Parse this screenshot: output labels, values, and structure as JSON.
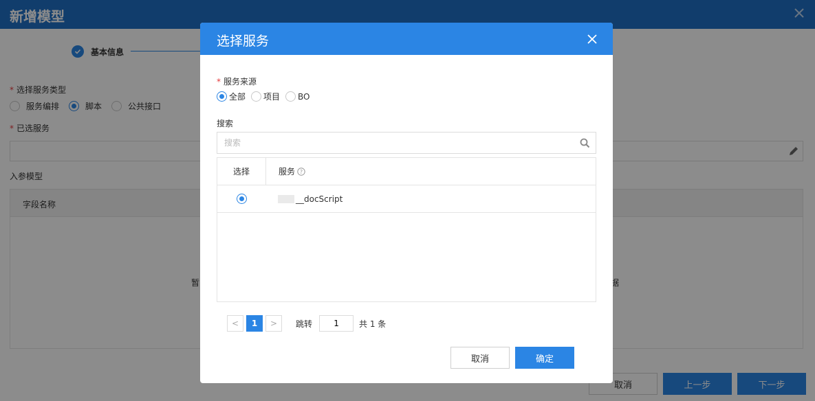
{
  "background": {
    "title": "新增模型",
    "step_label": "基本信息",
    "service_type_label": "选择服务类型",
    "service_types": [
      {
        "label": "服务编排",
        "selected": false
      },
      {
        "label": "脚本",
        "selected": true
      },
      {
        "label": "公共接口",
        "selected": false
      }
    ],
    "selected_service_label": "已选服务",
    "input_model_label": "入参模型",
    "field_name_header": "字段名称",
    "empty_left": "暂",
    "empty_right": "据",
    "buttons": {
      "cancel": "取消",
      "prev": "上一步",
      "next": "下一步"
    }
  },
  "modal": {
    "title": "选择服务",
    "source_label": "服务来源",
    "sources": [
      {
        "label": "全部",
        "selected": true
      },
      {
        "label": "项目",
        "selected": false
      },
      {
        "label": "BO",
        "selected": false
      }
    ],
    "search_label": "搜索",
    "search_placeholder": "搜索",
    "table": {
      "headers": {
        "select": "选择",
        "service": "服务"
      },
      "rows": [
        {
          "service": "__docScript",
          "selected": true
        }
      ]
    },
    "pagination": {
      "prev": "<",
      "current": "1",
      "next": ">",
      "jump_label": "跳转",
      "jump_value": "1",
      "total": "共 1 条"
    },
    "buttons": {
      "cancel": "取消",
      "ok": "确定"
    }
  },
  "colors": {
    "primary": "#2b85e4",
    "header": "#1f6fc5",
    "required": "#e4393c"
  }
}
